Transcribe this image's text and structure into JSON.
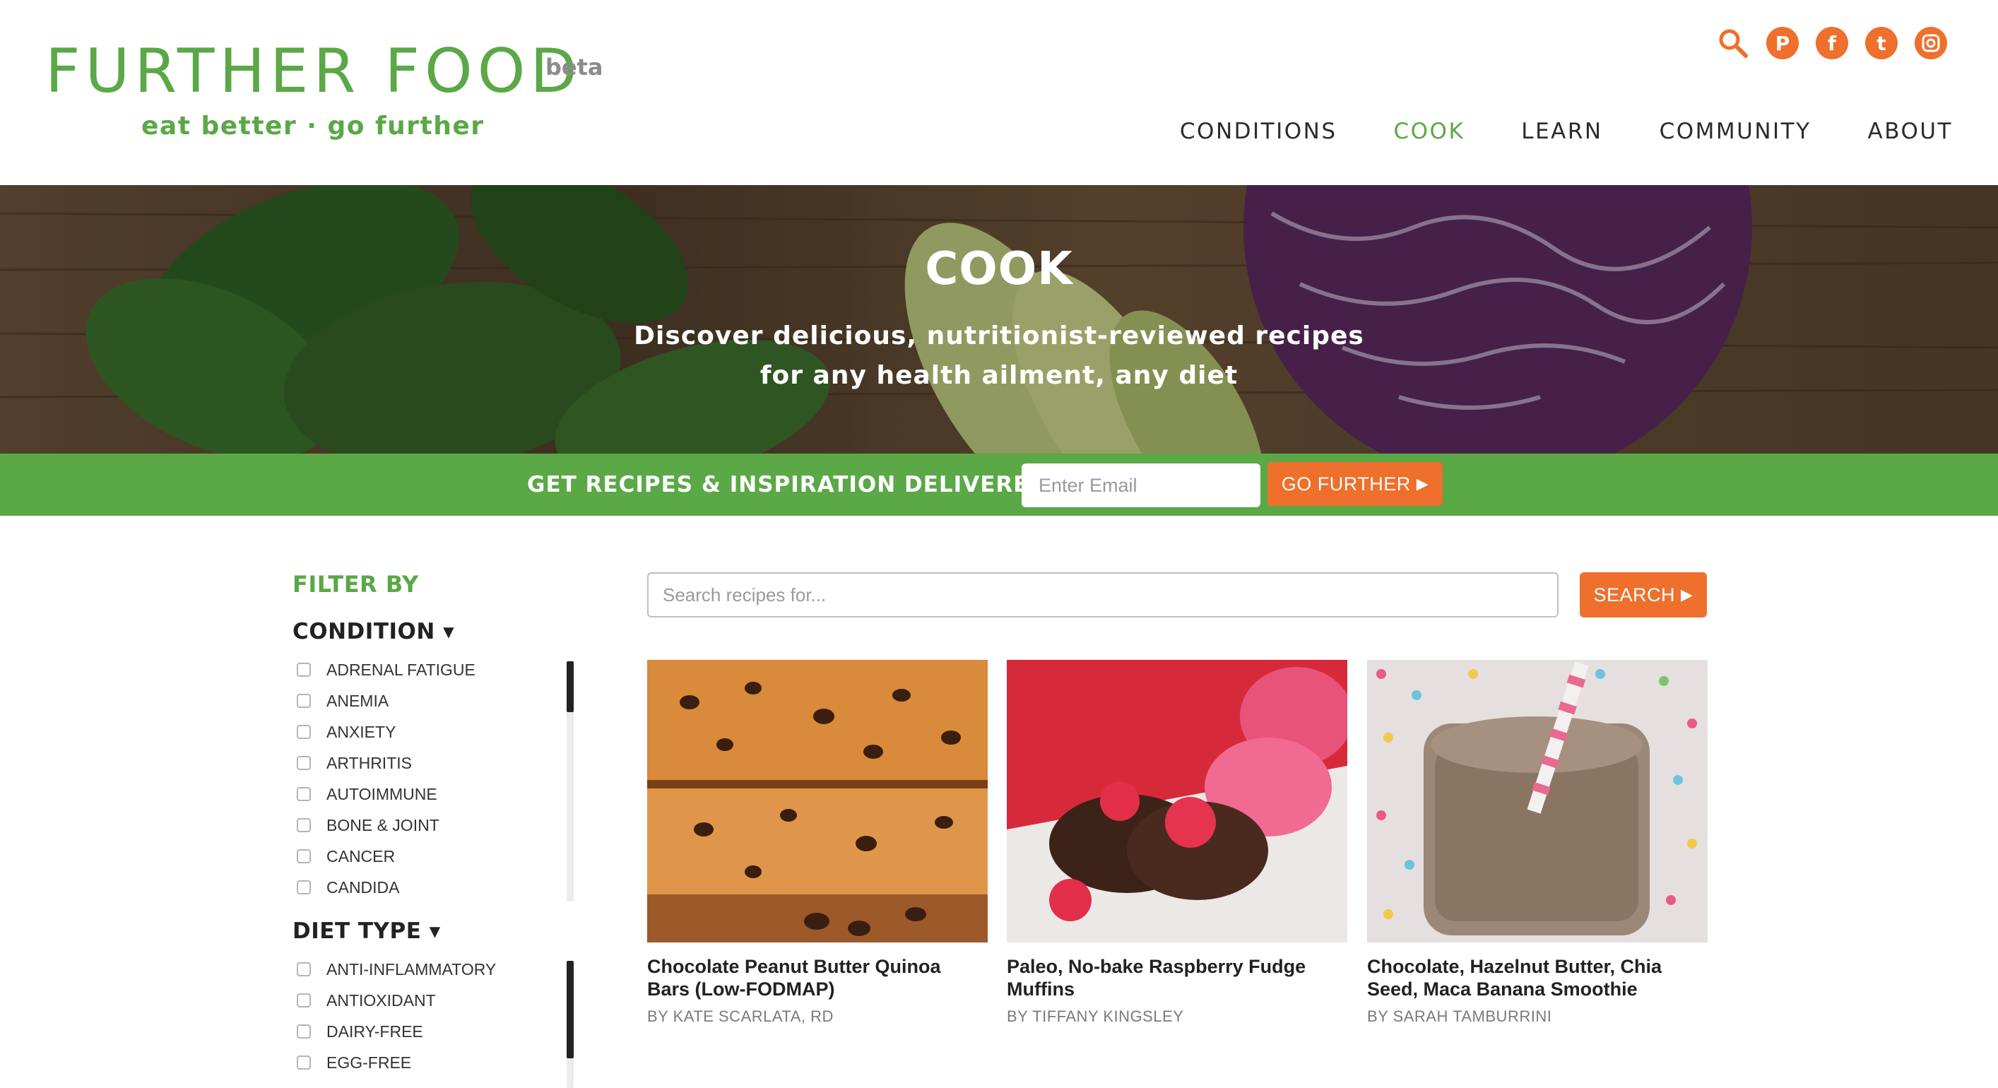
{
  "header": {
    "logo_title": "FURTHER FOOD",
    "logo_beta": "beta",
    "tagline": "eat better · go further",
    "social": [
      {
        "icon": "search-icon",
        "glyph": "⚲"
      },
      {
        "icon": "pinterest-icon",
        "glyph": "P"
      },
      {
        "icon": "facebook-icon",
        "glyph": "f"
      },
      {
        "icon": "twitter-icon",
        "glyph": "t"
      },
      {
        "icon": "instagram-icon",
        "glyph": "◎"
      }
    ],
    "nav": [
      {
        "label": "CONDITIONS",
        "active": false
      },
      {
        "label": "COOK",
        "active": true
      },
      {
        "label": "LEARN",
        "active": false
      },
      {
        "label": "COMMUNITY",
        "active": false
      },
      {
        "label": "ABOUT",
        "active": false
      }
    ]
  },
  "hero": {
    "title": "COOK",
    "subtitle_line1": "Discover delicious, nutritionist-reviewed recipes",
    "subtitle_line2": "for any health ailment, any diet"
  },
  "newsletter": {
    "label": "GET RECIPES & INSPIRATION DELIVERED!",
    "email_placeholder": "Enter Email",
    "button_label": "GO FURTHER"
  },
  "filter": {
    "title": "FILTER BY",
    "condition": {
      "heading": "CONDITION ▾",
      "options": [
        "ADRENAL FATIGUE",
        "ANEMIA",
        "ANXIETY",
        "ARTHRITIS",
        "AUTOIMMUNE",
        "BONE & JOINT",
        "CANCER",
        "CANDIDA"
      ]
    },
    "diet_type": {
      "heading": "DIET TYPE ▾",
      "options": [
        "ANTI-INFLAMMATORY",
        "ANTIOXIDANT",
        "DAIRY-FREE",
        "EGG-FREE"
      ]
    }
  },
  "search": {
    "placeholder": "Search recipes for...",
    "button_label": "SEARCH"
  },
  "recipes": [
    {
      "title_line1": "Chocolate Peanut Butter Quinoa",
      "title_line2": "Bars (Low-FODMAP)",
      "author": "BY KATE SCARLATA, RD"
    },
    {
      "title_line1": "Paleo, No-bake Raspberry Fudge",
      "title_line2": "Muffins",
      "author": "BY TIFFANY KINGSLEY"
    },
    {
      "title_line1": "Chocolate, Hazelnut Butter, Chia",
      "title_line2": "Seed, Maca Banana Smoothie",
      "author": "BY SARAH TAMBURRINI"
    }
  ],
  "colors": {
    "brand_green": "#5aa846",
    "accent_orange": "#ef6f2c",
    "logo_beta_gray": "#8c8c8c"
  }
}
